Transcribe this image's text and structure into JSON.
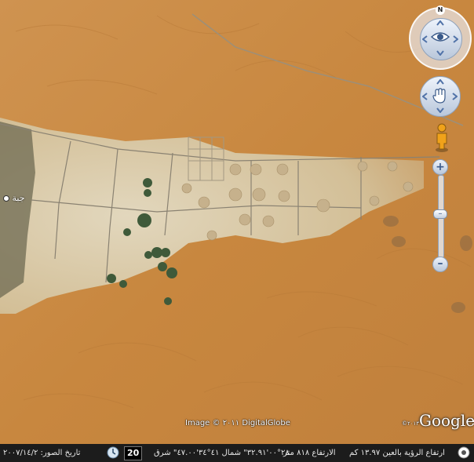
{
  "map": {
    "place_label": "جبة",
    "attribution": "Image © ٢٠١١ DigitalGlobe",
    "logo": "Google",
    "logo_year": "©٢٠١٣"
  },
  "controls": {
    "compass_label": "N"
  },
  "status": {
    "image_date": "تاريخ الصور: ٢٠٠٧/١٤/٢",
    "year_badge": "20",
    "coordinates": "٢٨°٠٠'٣٢.٩١\" شمال  ٤١°٣٤'٤٧.٠٠\" شرق",
    "elevation": "الارتفاع ٨١٨ متر",
    "eye_altitude": "ارتفاع الرؤية بالعين ١٣.٩٧ كم"
  },
  "colors": {
    "sand": "#c98a45",
    "farmland": "#d8c9a6",
    "statusbar": "#1c1c1c"
  }
}
